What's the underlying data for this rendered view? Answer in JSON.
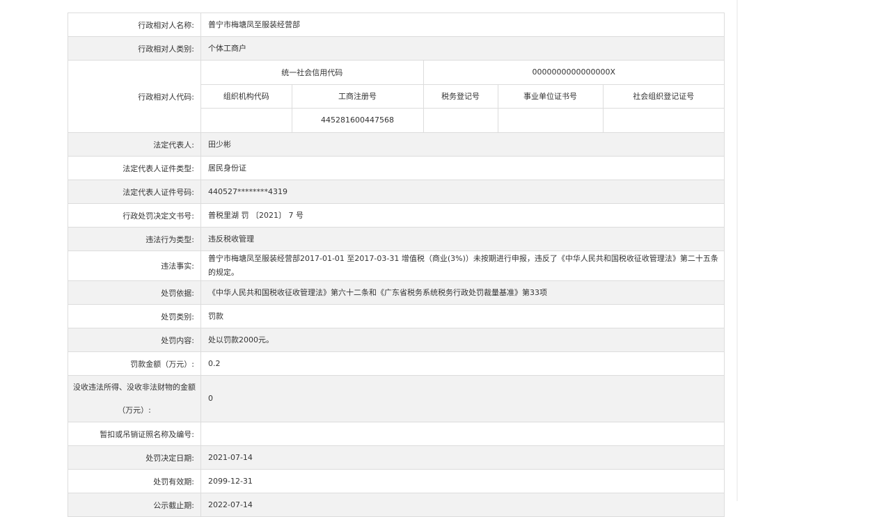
{
  "rows_top": [
    {
      "label": "行政相对人名称:",
      "value": "普宁市梅塘凤至服装经营部"
    },
    {
      "label": "行政相对人类别:",
      "value": "个体工商户"
    }
  ],
  "code_section": {
    "label": "行政相对人代码:",
    "credit_code_label": "统一社会信用代码",
    "credit_code_value": "0000000000000000X",
    "headers": [
      "组织机构代码",
      "工商注册号",
      "税务登记号",
      "事业单位证书号",
      "社会组织登记证号"
    ],
    "values": [
      "",
      "445281600447568",
      "",
      "",
      ""
    ]
  },
  "rows_bottom": [
    {
      "label": "法定代表人:",
      "value": "田少彬"
    },
    {
      "label": "法定代表人证件类型:",
      "value": "居民身份证"
    },
    {
      "label": "法定代表人证件号码:",
      "value": "440527********4319"
    },
    {
      "label": "行政处罚决定文书号:",
      "value": "普税里湖 罚 〔2021〕 7 号"
    },
    {
      "label": "违法行为类型:",
      "value": "违反税收管理"
    },
    {
      "label": "违法事实:",
      "value": "普宁市梅塘凤至服装经营部2017-01-01 至2017-03-31 增值税（商业(3%)）未按期进行申报，违反了《中华人民共和国税收征收管理法》第二十五条的规定。"
    },
    {
      "label": "处罚依据:",
      "value": "《中华人民共和国税收征收管理法》第六十二条和《广东省税务系统税务行政处罚裁量基准》第33项"
    },
    {
      "label": "处罚类别:",
      "value": "罚款"
    },
    {
      "label": "处罚内容:",
      "value": "处以罚款2000元。"
    },
    {
      "label": "罚款金额（万元）:",
      "value": "0.2"
    },
    {
      "label": "没收违法所得、没收非法财物的金额（万元）:",
      "value": "0"
    },
    {
      "label": "暂扣或吊销证照名称及编号:",
      "value": ""
    },
    {
      "label": "处罚决定日期:",
      "value": "2021-07-14"
    },
    {
      "label": "处罚有效期:",
      "value": "2099-12-31"
    },
    {
      "label": "公示截止期:",
      "value": "2022-07-14"
    }
  ]
}
